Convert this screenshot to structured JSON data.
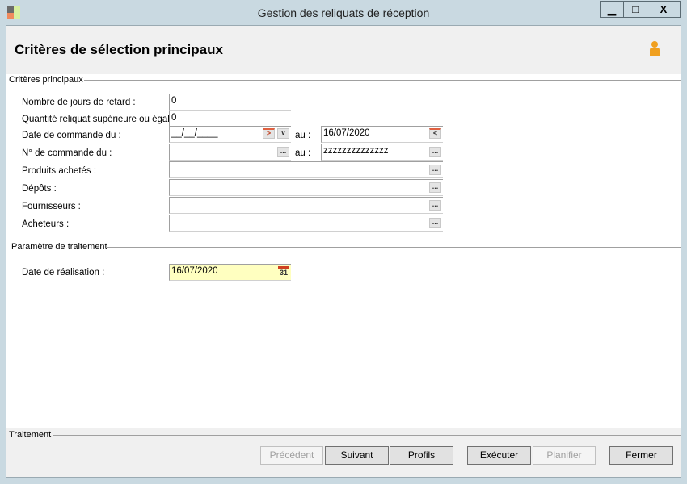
{
  "window": {
    "title": "Gestion des reliquats de réception",
    "min": "▁",
    "max": "□",
    "close": "X"
  },
  "header": {
    "title": "Critères de sélection principaux",
    "icon": "person-icon"
  },
  "group_main": {
    "label": "Critères principaux",
    "rows": [
      {
        "label": "Nombre de jours de retard :",
        "value": "0"
      },
      {
        "label": "Quantité reliquat supérieure ou égale :",
        "value": "0"
      },
      {
        "label": "Date de commande du :",
        "value": "__/__/____",
        "to_label": "au :",
        "to_value": "16/07/2020"
      },
      {
        "label": "N° de commande du :",
        "value": "",
        "to_label": "au :",
        "to_value": "zzzzzzzzzzzzzz"
      },
      {
        "label": "Produits achetés :",
        "value": ""
      },
      {
        "label": "Dépôts :",
        "value": ""
      },
      {
        "label": "Fournisseurs :",
        "value": ""
      },
      {
        "label": "Acheteurs :",
        "value": ""
      }
    ]
  },
  "group_params": {
    "label": "Paramètre de traitement",
    "date_label": "Date de réalisation :",
    "date_value": "16/07/2020",
    "cal_day": "31"
  },
  "group_treatment": {
    "label": "Traitement"
  },
  "buttons": {
    "prev": "Précédent",
    "next": "Suivant",
    "profiles": "Profils",
    "execute": "Exécuter",
    "schedule": "Planifier",
    "close": "Fermer"
  },
  "ellipsis": "..."
}
